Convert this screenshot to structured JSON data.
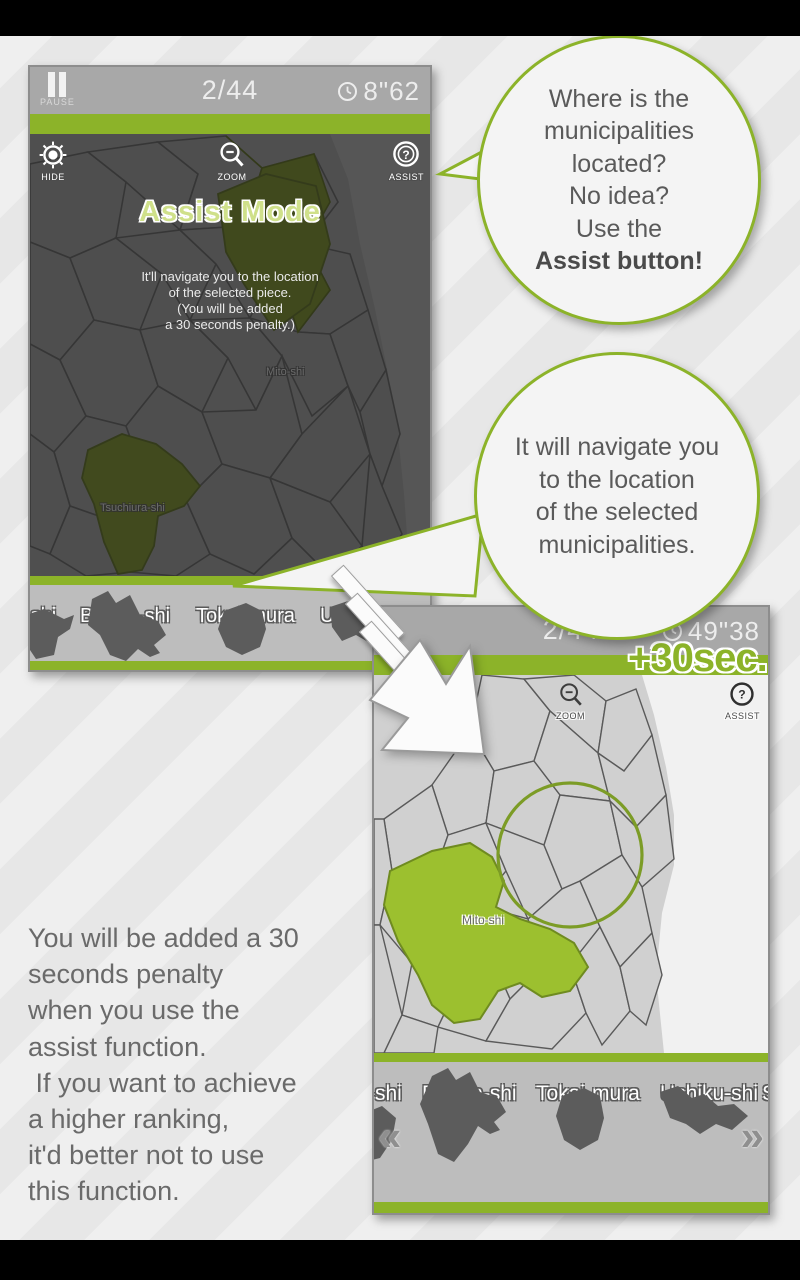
{
  "screen1": {
    "topbar": {
      "counter": "2/44",
      "timer": "8\"62",
      "pause_label": "PAUSE"
    },
    "hud": [
      {
        "name": "hide",
        "label": "HIDE",
        "icon": "gear-icon"
      },
      {
        "name": "zoom",
        "label": "ZOOM",
        "icon": "magnifier-minus-icon"
      },
      {
        "name": "assist",
        "label": "ASSIST",
        "icon": "question-circle-icon"
      }
    ],
    "overlay": {
      "title": "Assist Mode",
      "lines": [
        "It'll navigate you to the location",
        "of the selected piece.",
        "(You will be added",
        "a 30 seconds penalty.)"
      ]
    },
    "map_labels": [
      "Mito-shi",
      "Tsuchiura-shi"
    ],
    "tray": {
      "names": [
        "-shi",
        "Bando-shi",
        "Tokai-mura",
        "Ushiku-shi"
      ]
    }
  },
  "screen2": {
    "topbar": {
      "counter": "2/44",
      "timer": "49\"38"
    },
    "hud": [
      {
        "name": "zoom",
        "label": "ZOOM",
        "icon": "magnifier-minus-icon"
      },
      {
        "name": "assist",
        "label": "ASSIST",
        "icon": "question-circle-icon"
      }
    ],
    "penalty_banner": "+30sec.",
    "map_labels": [
      "Mito-shi"
    ],
    "tray": {
      "names": [
        "-shi",
        "Bando-shi",
        "Tokai-mura",
        "Ushiku-shi",
        "S"
      ],
      "prev_chevron": "«",
      "next_chevron": "»"
    }
  },
  "bubble1": {
    "lines": [
      {
        "text": "Where is the",
        "bold": false
      },
      {
        "text": "municipalities",
        "bold": false
      },
      {
        "text": "located?",
        "bold": false
      },
      {
        "text": "No idea?",
        "bold": false
      },
      {
        "text": "Use the",
        "bold": false
      },
      {
        "text": "Assist button!",
        "bold": true
      }
    ]
  },
  "bubble2": {
    "lines": [
      {
        "text": "It will navigate you",
        "bold": false
      },
      {
        "text": "to the location",
        "bold": false
      },
      {
        "text": "of the selected",
        "bold": false
      },
      {
        "text": "municipalities.",
        "bold": false
      }
    ]
  },
  "caption": {
    "lines": [
      "You will be added a 30",
      "seconds penalty",
      "when you use the",
      "assist function.",
      " If you want to achieve",
      "a higher ranking,",
      "it'd better not to use",
      "this function."
    ]
  },
  "colors": {
    "accent_green": "#8cb329",
    "piece_green": "#9cc02f",
    "topbar_gray": "#a8a8a8",
    "map_gray": "#cfcfcf",
    "letterbox": "#000000",
    "text_gray": "#6a6a6a"
  }
}
